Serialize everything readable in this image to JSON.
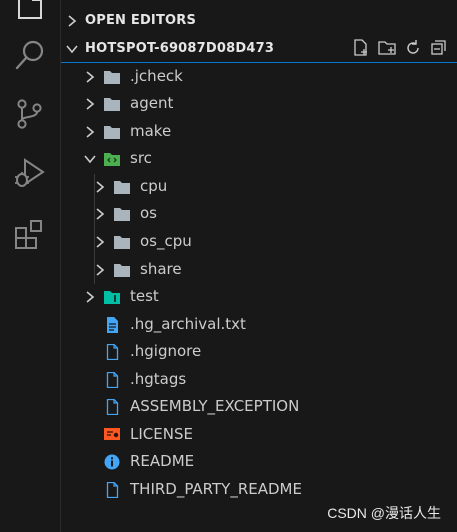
{
  "activity_bar": {
    "icons": [
      "explorer-icon",
      "search-icon",
      "source-control-icon",
      "run-debug-icon",
      "extensions-icon"
    ]
  },
  "sidebar": {
    "open_editors_title": "OPEN EDITORS",
    "project_title": "HOTSPOT-69087D08D473",
    "toolbar": [
      "new-file-icon",
      "new-folder-icon",
      "refresh-icon",
      "collapse-all-icon"
    ],
    "tree": [
      {
        "label": ".jcheck",
        "type": "folder",
        "expanded": false
      },
      {
        "label": "agent",
        "type": "folder",
        "expanded": false
      },
      {
        "label": "make",
        "type": "folder",
        "expanded": false
      },
      {
        "label": "src",
        "type": "folder-src",
        "expanded": true
      },
      {
        "label": "cpu",
        "type": "folder",
        "expanded": false
      },
      {
        "label": "os",
        "type": "folder",
        "expanded": false
      },
      {
        "label": "os_cpu",
        "type": "folder",
        "expanded": false
      },
      {
        "label": "share",
        "type": "folder",
        "expanded": false
      },
      {
        "label": "test",
        "type": "folder-test",
        "expanded": false
      },
      {
        "label": ".hg_archival.txt",
        "type": "text-file"
      },
      {
        "label": ".hgignore",
        "type": "file"
      },
      {
        "label": ".hgtags",
        "type": "file"
      },
      {
        "label": "ASSEMBLY_EXCEPTION",
        "type": "file"
      },
      {
        "label": "LICENSE",
        "type": "license-file"
      },
      {
        "label": "README",
        "type": "info-file"
      },
      {
        "label": "THIRD_PARTY_README",
        "type": "file"
      }
    ]
  },
  "watermark": "CSDN @漫话人生",
  "colors": {
    "background": "#181818",
    "accent": "#0078d4",
    "folder": "#a9b4bd",
    "src_folder": "#4caf50",
    "test_folder": "#00bfa5",
    "text_file": "#42a5f5",
    "license": "#ff5722",
    "info": "#42a5f5"
  }
}
